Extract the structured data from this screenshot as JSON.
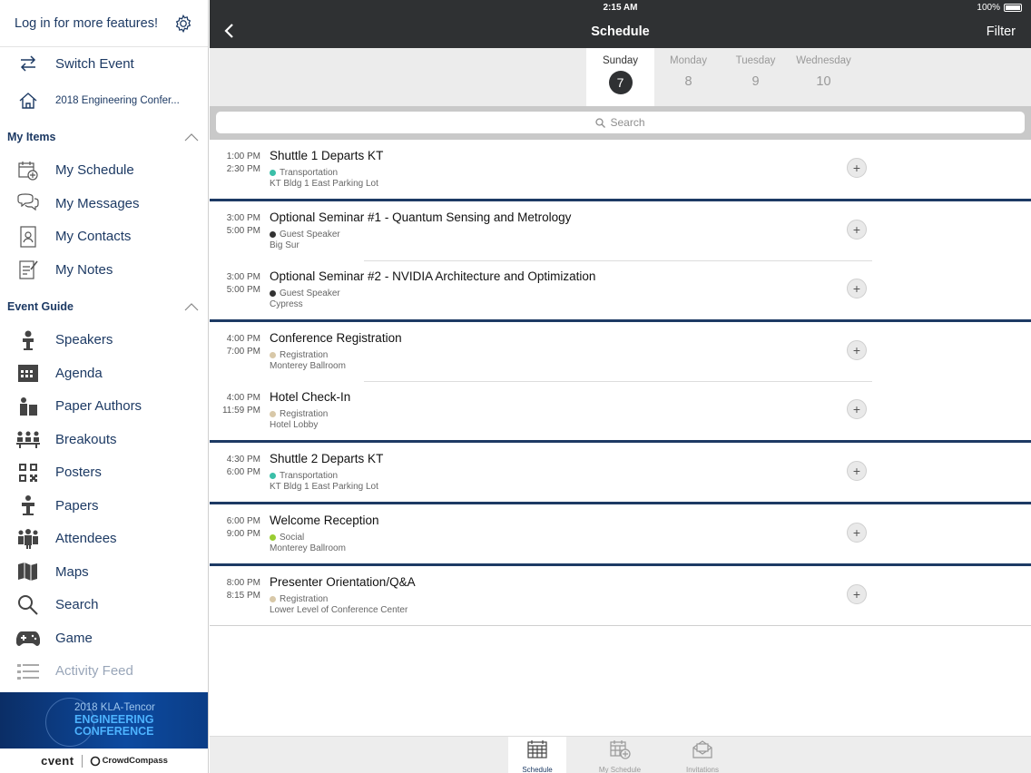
{
  "sidebar": {
    "login_text": "Log in for more features!",
    "top_items": [
      {
        "label": "Switch Event",
        "icon": "switch-arrows-icon"
      },
      {
        "label": "2018 Engineering Confer...",
        "icon": "home-icon"
      }
    ],
    "my_items_header": "My Items",
    "my_items": [
      {
        "label": "My Schedule",
        "icon": "calendar-plus-icon"
      },
      {
        "label": "My Messages",
        "icon": "messages-icon"
      },
      {
        "label": "My Contacts",
        "icon": "contacts-icon"
      },
      {
        "label": "My Notes",
        "icon": "notes-icon"
      }
    ],
    "event_guide_header": "Event Guide",
    "event_guide": [
      {
        "label": "Speakers",
        "icon": "speaker-icon"
      },
      {
        "label": "Agenda",
        "icon": "agenda-icon"
      },
      {
        "label": "Paper Authors",
        "icon": "authors-icon"
      },
      {
        "label": "Breakouts",
        "icon": "breakouts-icon"
      },
      {
        "label": "Posters",
        "icon": "qr-code-icon"
      },
      {
        "label": "Papers",
        "icon": "papers-icon"
      },
      {
        "label": "Attendees",
        "icon": "attendees-icon"
      },
      {
        "label": "Maps",
        "icon": "map-icon"
      },
      {
        "label": "Search",
        "icon": "search-icon"
      },
      {
        "label": "Game",
        "icon": "gamepad-icon"
      },
      {
        "label": "Activity Feed",
        "icon": "activity-feed-icon"
      }
    ],
    "banner_line1": "2018 KLA-Tencor",
    "banner_line2": "ENGINEERING",
    "banner_line3": "CONFERENCE",
    "footer_cvent": "cvent",
    "footer_crowdcompass": "CrowdCompass"
  },
  "status": {
    "time": "2:15 AM",
    "battery": "100%"
  },
  "header": {
    "title": "Schedule",
    "filter": "Filter"
  },
  "days": [
    {
      "name": "Sunday",
      "num": "7"
    },
    {
      "name": "Monday",
      "num": "8"
    },
    {
      "name": "Tuesday",
      "num": "9"
    },
    {
      "name": "Wednesday",
      "num": "10"
    }
  ],
  "search": {
    "placeholder": "Search"
  },
  "groups": [
    {
      "events": [
        {
          "start": "1:00 PM",
          "end": "2:30 PM",
          "title": "Shuttle 1 Departs KT",
          "category": "Transportation",
          "color": "#3bbfa8",
          "location": "KT Bldg 1 East Parking Lot"
        }
      ]
    },
    {
      "events": [
        {
          "start": "3:00 PM",
          "end": "5:00 PM",
          "title": "Optional Seminar #1 - Quantum Sensing and Metrology",
          "category": "Guest Speaker",
          "color": "#333333",
          "location": "Big Sur"
        },
        {
          "start": "3:00 PM",
          "end": "5:00 PM",
          "title": "Optional Seminar #2 - NVIDIA Architecture and Optimization",
          "category": "Guest Speaker",
          "color": "#333333",
          "location": "Cypress"
        }
      ]
    },
    {
      "events": [
        {
          "start": "4:00 PM",
          "end": "7:00 PM",
          "title": "Conference Registration",
          "category": "Registration",
          "color": "#d8c8a8",
          "location": "Monterey Ballroom"
        },
        {
          "start": "4:00 PM",
          "end": "11:59 PM",
          "title": "Hotel Check-In",
          "category": "Registration",
          "color": "#d8c8a8",
          "location": "Hotel Lobby"
        }
      ]
    },
    {
      "events": [
        {
          "start": "4:30 PM",
          "end": "6:00 PM",
          "title": "Shuttle 2 Departs KT",
          "category": "Transportation",
          "color": "#3bbfa8",
          "location": "KT Bldg 1 East Parking Lot"
        }
      ]
    },
    {
      "events": [
        {
          "start": "6:00 PM",
          "end": "9:00 PM",
          "title": "Welcome Reception",
          "category": "Social",
          "color": "#9acd32",
          "location": "Monterey Ballroom"
        }
      ]
    },
    {
      "events": [
        {
          "start": "8:00 PM",
          "end": "8:15 PM",
          "title": "Presenter Orientation/Q&A",
          "category": "Registration",
          "color": "#d8c8a8",
          "location": "Lower Level of Conference Center"
        }
      ]
    }
  ],
  "tabs": [
    {
      "label": "Schedule",
      "icon": "schedule-tab-icon"
    },
    {
      "label": "My Schedule",
      "icon": "my-schedule-tab-icon"
    },
    {
      "label": "Invitations",
      "icon": "invitations-tab-icon"
    }
  ]
}
